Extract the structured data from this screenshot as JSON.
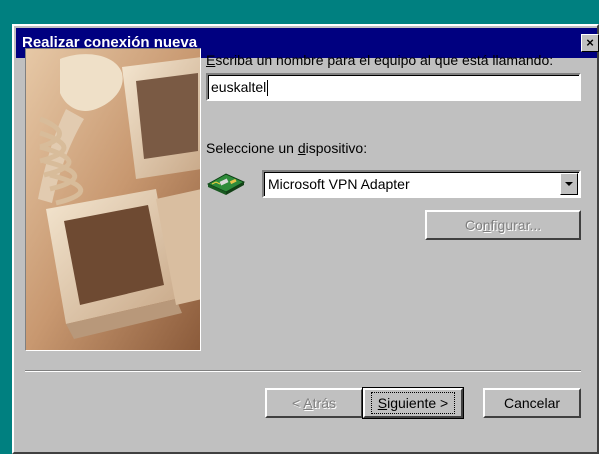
{
  "window": {
    "title": "Realizar conexión nueva",
    "close_symbol": "×"
  },
  "form": {
    "name_label": {
      "mnemonic": "E",
      "rest": "scriba un nombre para el equipo al que está llamando:"
    },
    "name_value": "euskaltel",
    "device_label": {
      "before": "Seleccione un ",
      "mnemonic": "d",
      "after": "ispositivo:"
    },
    "device_icon": "modem-card-icon",
    "device_selected": "Microsoft VPN Adapter",
    "configure_button": {
      "before": "Co",
      "mnemonic": "n",
      "after": "figurar..."
    }
  },
  "buttons": {
    "back": {
      "before": "< ",
      "mnemonic": "A",
      "after": "trás"
    },
    "next": {
      "mnemonic": "S",
      "after": "iguiente >"
    },
    "cancel": "Cancelar"
  },
  "colors": {
    "desktop": "#008080",
    "titlebar": "#000080",
    "face": "#c0c0c0"
  }
}
